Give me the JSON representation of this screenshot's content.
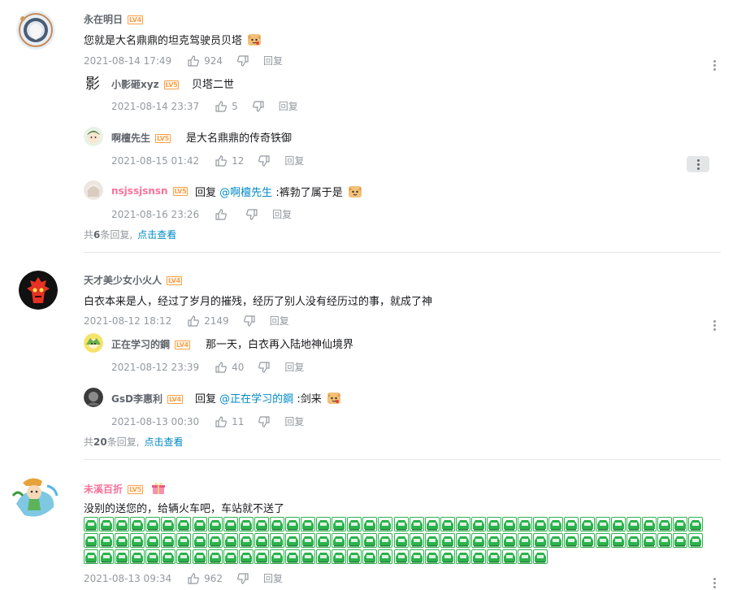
{
  "comments": [
    {
      "username": "永在明日",
      "level": "LV4",
      "text": "您就是大名鼎鼎的坦克驾驶员贝塔",
      "time": "2021-08-14 17:49",
      "likes": "924",
      "reply_label": "回复",
      "replies": [
        {
          "username": "小影砸xyz",
          "level": "LV5",
          "text": "贝塔二世",
          "time": "2021-08-14 23:37",
          "likes": "5",
          "reply_label": "回复"
        },
        {
          "username": "啊檀先生",
          "level": "LV5",
          "text": "是大名鼎鼎的传奇铁御",
          "time": "2021-08-15 01:42",
          "likes": "12",
          "reply_label": "回复"
        },
        {
          "username": "nsjssjsnsn",
          "level": "LV5",
          "prefix": "回复",
          "mention": "@啊檀先生",
          "text": ":裤勃了属于是",
          "time": "2021-08-16 23:26",
          "likes": "",
          "reply_label": "回复"
        }
      ],
      "summary_prefix": "共",
      "summary_count": "6",
      "summary_suffix": "条回复,",
      "summary_link": "点击查看"
    },
    {
      "username": "天才美少女小火人",
      "level": "LV4",
      "text": "白衣本来是人，经过了岁月的摧残，经历了别人没有经历过的事，就成了神",
      "time": "2021-08-12 18:12",
      "likes": "2149",
      "reply_label": "回复",
      "replies": [
        {
          "username": "正在学习的鋼",
          "level": "LV4",
          "text": "那一天，白衣再入陆地神仙境界",
          "time": "2021-08-12 23:39",
          "likes": "40",
          "reply_label": "回复"
        },
        {
          "username": "GsD李惠利",
          "level": "LV4",
          "prefix": "回复",
          "mention": "@正在学习的鋼",
          "text": ":剑来",
          "time": "2021-08-13 00:30",
          "likes": "11",
          "reply_label": "回复"
        }
      ],
      "summary_prefix": "共",
      "summary_count": "20",
      "summary_suffix": "条回复,",
      "summary_link": "点击查看"
    },
    {
      "username": "未溪百折",
      "level": "LV5",
      "text": "没别的送您的，给辆火车吧，车站就不送了",
      "train_emoji_count": 110,
      "time": "2021-08-13 09:34",
      "likes": "962",
      "reply_label": "回复"
    }
  ],
  "colors": {
    "accent_link": "#008ac5",
    "vip_name": "#fb7299",
    "meta_gray": "#9499a0",
    "level_badge": "#ff9f43",
    "train_green": "#2bb24c"
  },
  "icons": [
    "thumbs-up-icon",
    "thumbs-down-icon",
    "more-vertical-icon",
    "dog-emoji-icon",
    "train-emoji-icon",
    "gift-icon"
  ]
}
